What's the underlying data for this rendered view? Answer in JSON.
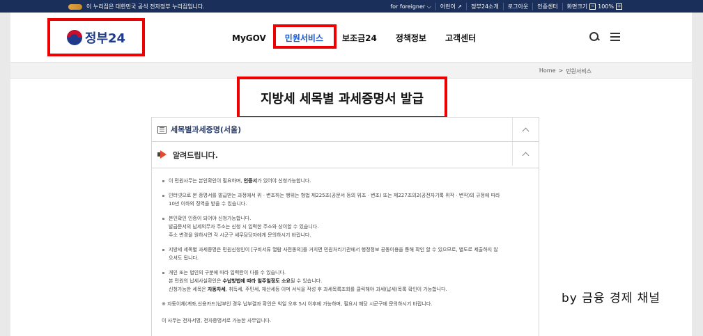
{
  "gov_bar": {
    "notice": "이 누리집은 대한민국 공식 전자정부 누리집입니다.",
    "links": [
      "for foreigner ⌵",
      "어린이 ↗",
      "정부24소개",
      "로그아웃",
      "인증센터"
    ],
    "zoom_label": "화면크기",
    "zoom_minus": "−",
    "zoom_value": "100%",
    "zoom_plus": "+"
  },
  "header": {
    "logo_text": "정부24",
    "nav": [
      "MyGOV",
      "민원서비스",
      "보조금24",
      "정책정보",
      "고객센터"
    ],
    "active_index": 1
  },
  "breadcrumb": [
    "Home",
    ">",
    "민원서비스"
  ],
  "page_title": "지방세 세목별 과세증명서 발급",
  "accordion": {
    "service_title": "세목별과세증명(서울)",
    "notice_title": "알려드립니다."
  },
  "notice": {
    "item1": {
      "pre": "이 민원사무는 본인확인이 필요하며, ",
      "bold": "인증서",
      "post": "가 있어야 신청가능합니다."
    },
    "item2_l1": "인터넷으로 본 증명서를 발급받는 과정에서 위 · 변조하는 행위는 형법 제225조(공문서 등의 위조 · 변조) 또는 제227조의2(공전자기록 위작 · 변작)의 규정에 따라",
    "item2_l2": "10년 이하의 징역을 받을 수 있습니다.",
    "item3_l1": "본인확인 인증이 되어야 신청가능합니다.",
    "item3_l2": "발급문서의 납세의무자 주소는 신청 시 입력한 주소와 상이할 수 있습니다.",
    "item3_l3": "주소 변경을 원하시면 각 시군구 세무담당자에게 문의하시기 바랍니다.",
    "item4_l1": "지방세 세목별 과세증명은 민원신청인이 [구비서류 열람 사전동의]를 거치면 민원처리기관에서 행정정보 공동이용을 통해 확인 할 수 있으므로, 별도로 제출하지 않",
    "item4_l2": "으셔도 됩니다.",
    "item5_l1": "개인 또는 법인의 구분에 따라 입력란이 다를 수 있습니다.",
    "item5_l2": {
      "pre": "본 민원의 납세사실확인은 ",
      "bold": "수납방법에 따라 일주일정도 소요",
      "post": "될 수 있습니다."
    },
    "item5_l3": {
      "pre": "신청가능한 세목은 ",
      "bold": "자동차세",
      "post": ", 취득세, 주민세, 재산세등 이며 서식을 작성 후 과세목록조회를 클릭해야 과세(납세)목록 확인이 가능합니다."
    },
    "ref": "※ 자동이체(계좌,신용카드)납부인 경우 납부결과 확인은 익일 오후 5시 이후에 가능하며, 필요시 해당 시군구에 문의하시기 바랍니다.",
    "last": "이 사무는 전자서명, 전자증명서로 가능한 사무입니다."
  },
  "watermark": "by 금융 경제 채널",
  "colors": {
    "gov_bar": "#1a2f5a",
    "accent": "#1a56c4",
    "highlight": "#ee0000"
  }
}
